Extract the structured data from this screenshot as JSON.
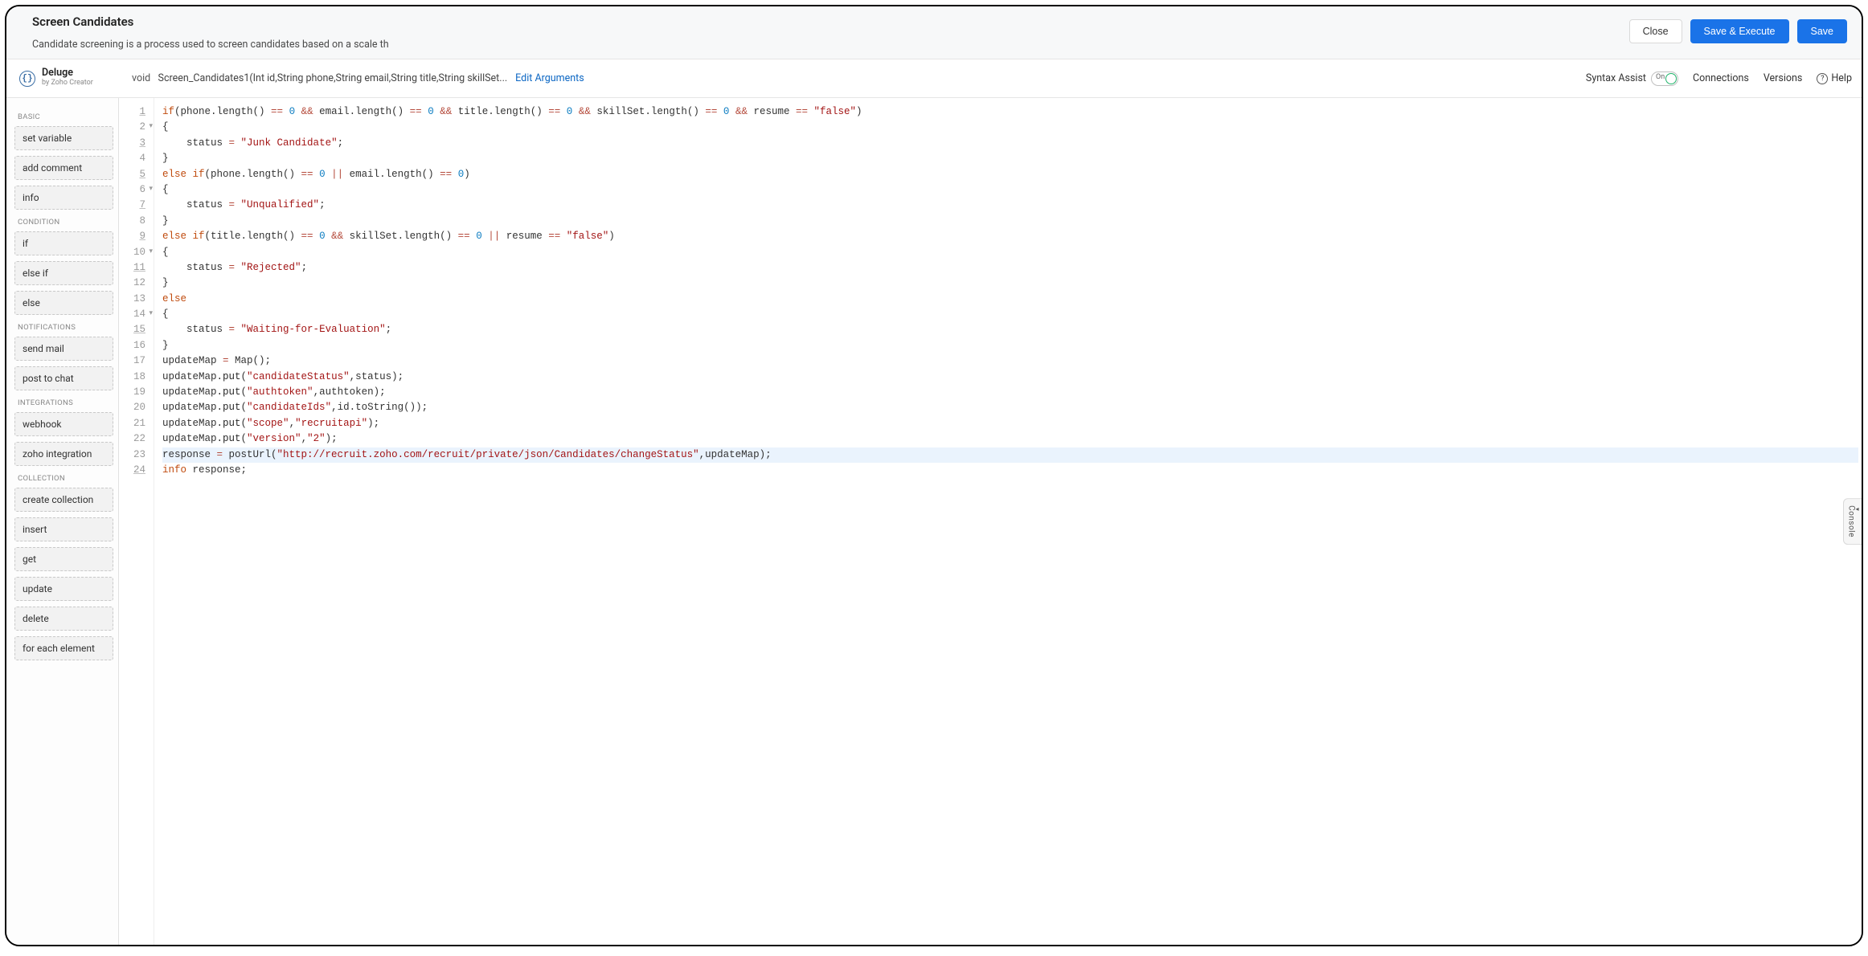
{
  "header": {
    "title": "Screen Candidates",
    "subtitle": "Candidate screening is a process used to screen candidates based on a scale th",
    "close_label": "Close",
    "save_execute_label": "Save & Execute",
    "save_label": "Save"
  },
  "brand": {
    "name": "Deluge",
    "subtitle": "by Zoho Creator"
  },
  "function_signature": {
    "return_type": "void",
    "text": "Screen_Candidates1(Int id,String phone,String email,String title,String skillSet...",
    "edit_label": "Edit Arguments"
  },
  "toolbar": {
    "syntax_assist_label": "Syntax Assist",
    "syntax_assist_state": "On",
    "connections_label": "Connections",
    "versions_label": "Versions",
    "help_label": "Help"
  },
  "sidebar": {
    "groups": [
      {
        "title": "BASIC",
        "items": [
          "set variable",
          "add comment",
          "info"
        ]
      },
      {
        "title": "CONDITION",
        "items": [
          "if",
          "else if",
          "else"
        ]
      },
      {
        "title": "NOTIFICATIONS",
        "items": [
          "send mail",
          "post to chat"
        ]
      },
      {
        "title": "INTEGRATIONS",
        "items": [
          "webhook",
          "zoho integration"
        ]
      },
      {
        "title": "COLLECTION",
        "items": [
          "create collection",
          "insert",
          "get",
          "update",
          "delete",
          "for each element"
        ]
      }
    ]
  },
  "editor": {
    "gutter": [
      {
        "n": 1,
        "underline": true
      },
      {
        "n": 2,
        "fold": true
      },
      {
        "n": 3,
        "underline": true
      },
      {
        "n": 4
      },
      {
        "n": 5,
        "underline": true
      },
      {
        "n": 6,
        "fold": true
      },
      {
        "n": 7,
        "underline": true
      },
      {
        "n": 8
      },
      {
        "n": 9,
        "underline": true
      },
      {
        "n": 10,
        "fold": true
      },
      {
        "n": 11,
        "underline": true
      },
      {
        "n": 12
      },
      {
        "n": 13
      },
      {
        "n": 14,
        "fold": true
      },
      {
        "n": 15,
        "underline": true
      },
      {
        "n": 16
      },
      {
        "n": 17
      },
      {
        "n": 18
      },
      {
        "n": 19
      },
      {
        "n": 20
      },
      {
        "n": 21
      },
      {
        "n": 22
      },
      {
        "n": 23
      },
      {
        "n": 24,
        "underline": true
      }
    ],
    "lines": [
      {
        "tokens": [
          {
            "t": "if",
            "c": "kw"
          },
          {
            "t": "(phone.length() "
          },
          {
            "t": "==",
            "c": "op"
          },
          {
            "t": " "
          },
          {
            "t": "0",
            "c": "num-lit"
          },
          {
            "t": " "
          },
          {
            "t": "&&",
            "c": "op"
          },
          {
            "t": " email.length() "
          },
          {
            "t": "==",
            "c": "op"
          },
          {
            "t": " "
          },
          {
            "t": "0",
            "c": "num-lit"
          },
          {
            "t": " "
          },
          {
            "t": "&&",
            "c": "op"
          },
          {
            "t": " title.length() "
          },
          {
            "t": "==",
            "c": "op"
          },
          {
            "t": " "
          },
          {
            "t": "0",
            "c": "num-lit"
          },
          {
            "t": " "
          },
          {
            "t": "&&",
            "c": "op"
          },
          {
            "t": " skillSet.length() "
          },
          {
            "t": "==",
            "c": "op"
          },
          {
            "t": " "
          },
          {
            "t": "0",
            "c": "num-lit"
          },
          {
            "t": " "
          },
          {
            "t": "&&",
            "c": "op"
          },
          {
            "t": " resume "
          },
          {
            "t": "==",
            "c": "op"
          },
          {
            "t": " "
          },
          {
            "t": "\"false\"",
            "c": "str"
          },
          {
            "t": ")"
          }
        ]
      },
      {
        "tokens": [
          {
            "t": "{"
          }
        ]
      },
      {
        "tokens": [
          {
            "t": "    status "
          },
          {
            "t": "=",
            "c": "op"
          },
          {
            "t": " "
          },
          {
            "t": "\"Junk Candidate\"",
            "c": "str"
          },
          {
            "t": ";"
          }
        ]
      },
      {
        "tokens": [
          {
            "t": "}"
          }
        ]
      },
      {
        "tokens": [
          {
            "t": "else if",
            "c": "kw"
          },
          {
            "t": "(phone.length() "
          },
          {
            "t": "==",
            "c": "op"
          },
          {
            "t": " "
          },
          {
            "t": "0",
            "c": "num-lit"
          },
          {
            "t": " "
          },
          {
            "t": "||",
            "c": "op"
          },
          {
            "t": " email.length() "
          },
          {
            "t": "==",
            "c": "op"
          },
          {
            "t": " "
          },
          {
            "t": "0",
            "c": "num-lit"
          },
          {
            "t": ")"
          }
        ]
      },
      {
        "tokens": [
          {
            "t": "{"
          }
        ]
      },
      {
        "tokens": [
          {
            "t": "    status "
          },
          {
            "t": "=",
            "c": "op"
          },
          {
            "t": " "
          },
          {
            "t": "\"Unqualified\"",
            "c": "str"
          },
          {
            "t": ";"
          }
        ]
      },
      {
        "tokens": [
          {
            "t": "}"
          }
        ]
      },
      {
        "tokens": [
          {
            "t": "else if",
            "c": "kw"
          },
          {
            "t": "(title.length() "
          },
          {
            "t": "==",
            "c": "op"
          },
          {
            "t": " "
          },
          {
            "t": "0",
            "c": "num-lit"
          },
          {
            "t": " "
          },
          {
            "t": "&&",
            "c": "op"
          },
          {
            "t": " skillSet.length() "
          },
          {
            "t": "==",
            "c": "op"
          },
          {
            "t": " "
          },
          {
            "t": "0",
            "c": "num-lit"
          },
          {
            "t": " "
          },
          {
            "t": "||",
            "c": "op"
          },
          {
            "t": " resume "
          },
          {
            "t": "==",
            "c": "op"
          },
          {
            "t": " "
          },
          {
            "t": "\"false\"",
            "c": "str"
          },
          {
            "t": ")"
          }
        ]
      },
      {
        "tokens": [
          {
            "t": "{"
          }
        ]
      },
      {
        "tokens": [
          {
            "t": "    status "
          },
          {
            "t": "=",
            "c": "op"
          },
          {
            "t": " "
          },
          {
            "t": "\"Rejected\"",
            "c": "str"
          },
          {
            "t": ";"
          }
        ]
      },
      {
        "tokens": [
          {
            "t": "}"
          }
        ]
      },
      {
        "tokens": [
          {
            "t": "else",
            "c": "kw"
          }
        ]
      },
      {
        "tokens": [
          {
            "t": "{"
          }
        ]
      },
      {
        "tokens": [
          {
            "t": "    status "
          },
          {
            "t": "=",
            "c": "op"
          },
          {
            "t": " "
          },
          {
            "t": "\"Waiting-for-Evaluation\"",
            "c": "str"
          },
          {
            "t": ";"
          }
        ]
      },
      {
        "tokens": [
          {
            "t": "}"
          }
        ]
      },
      {
        "tokens": [
          {
            "t": "updateMap "
          },
          {
            "t": "=",
            "c": "op"
          },
          {
            "t": " Map();"
          }
        ]
      },
      {
        "tokens": [
          {
            "t": "updateMap"
          },
          {
            "t": ".put",
            "c": "var"
          },
          {
            "t": "("
          },
          {
            "t": "\"candidateStatus\"",
            "c": "str"
          },
          {
            "t": ",status);"
          }
        ]
      },
      {
        "tokens": [
          {
            "t": "updateMap"
          },
          {
            "t": ".put",
            "c": "var"
          },
          {
            "t": "("
          },
          {
            "t": "\"authtoken\"",
            "c": "str"
          },
          {
            "t": ",authtoken);"
          }
        ]
      },
      {
        "tokens": [
          {
            "t": "updateMap"
          },
          {
            "t": ".put",
            "c": "var"
          },
          {
            "t": "("
          },
          {
            "t": "\"candidateIds\"",
            "c": "str"
          },
          {
            "t": ",id.toString());"
          }
        ]
      },
      {
        "tokens": [
          {
            "t": "updateMap"
          },
          {
            "t": ".put",
            "c": "var"
          },
          {
            "t": "("
          },
          {
            "t": "\"scope\"",
            "c": "str"
          },
          {
            "t": ","
          },
          {
            "t": "\"recruitapi\"",
            "c": "str"
          },
          {
            "t": ");"
          }
        ]
      },
      {
        "tokens": [
          {
            "t": "updateMap"
          },
          {
            "t": ".put",
            "c": "var"
          },
          {
            "t": "("
          },
          {
            "t": "\"version\"",
            "c": "str"
          },
          {
            "t": ","
          },
          {
            "t": "\"2\"",
            "c": "str"
          },
          {
            "t": ");"
          }
        ]
      },
      {
        "highlight": true,
        "tokens": [
          {
            "t": "response "
          },
          {
            "t": "=",
            "c": "op"
          },
          {
            "t": " postUrl("
          },
          {
            "t": "\"http://recruit.zoho.com/recruit/private/json/Candidates/changeStatus\"",
            "c": "str"
          },
          {
            "t": ",updateMap);"
          }
        ]
      },
      {
        "tokens": [
          {
            "t": "info",
            "c": "kw"
          },
          {
            "t": " response;"
          }
        ]
      }
    ]
  },
  "console_tab": "Console"
}
